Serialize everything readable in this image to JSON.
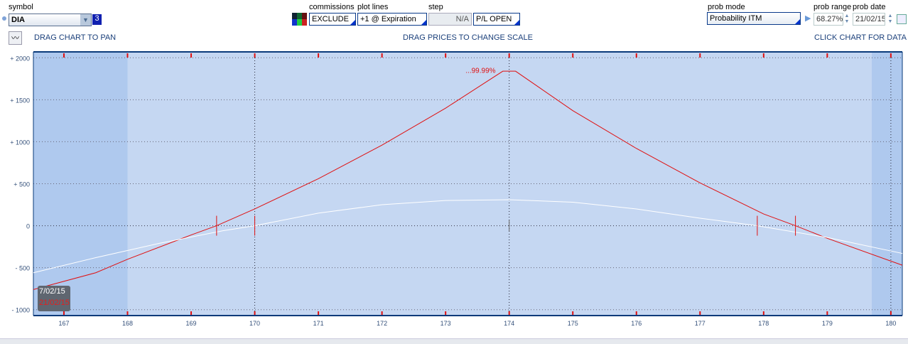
{
  "header": {
    "symbol_label": "symbol",
    "symbol_value": "DIA",
    "symbol_count": "3",
    "commissions_label": "commissions",
    "commissions_value": "EXCLUDE",
    "plot_lines_label": "plot lines",
    "plot_lines_value": "+1 @ Expiration",
    "step_label": "step",
    "step_value": "N/A",
    "pl_mode": "P/L OPEN",
    "prob_mode_label": "prob mode",
    "prob_mode_value": "Probability ITM",
    "prob_range_label": "prob range",
    "prob_range_value": "68.27%",
    "prob_date_label": "prob date",
    "prob_date_value": "21/02/15"
  },
  "hints": {
    "pan": "DRAG CHART TO PAN",
    "scale": "DRAG PRICES TO CHANGE SCALE",
    "data": "CLICK CHART FOR DATA"
  },
  "legend": {
    "t0_date": "7/02/15",
    "exp_date": "21/02/15"
  },
  "colors": {
    "expiration": "#e01010",
    "today": "#ffffff",
    "bg": "#c5d7f2",
    "bg_outside": "#afc9ee"
  },
  "chart_data": {
    "type": "line",
    "xlim": [
      166.52,
      180.18
    ],
    "ylim": [
      -1070,
      2070
    ],
    "xticks": [
      167,
      168,
      169,
      170,
      171,
      172,
      173,
      174,
      175,
      176,
      177,
      178,
      179,
      180
    ],
    "yticks": [
      {
        "v": 2000,
        "label": "+ 2000"
      },
      {
        "v": 1500,
        "label": "+ 1500"
      },
      {
        "v": 1000,
        "label": "+ 1000"
      },
      {
        "v": 500,
        "label": "+ 500"
      },
      {
        "v": 0,
        "label": "0"
      },
      {
        "v": -500,
        "label": "- 500"
      },
      {
        "v": -1000,
        "label": "- 1000"
      }
    ],
    "prob_range": [
      168,
      179.7
    ],
    "peak_label": "...99.99%",
    "series": [
      {
        "name": "21/02/15",
        "x": [
          166.52,
          167.5,
          168,
          169,
          169.4,
          170,
          171,
          172,
          173,
          173.9,
          174.1,
          175,
          176,
          177,
          178,
          178.5,
          179,
          180.18
        ],
        "y": [
          -760,
          -560,
          -400,
          -110,
          0,
          200,
          560,
          960,
          1400,
          1840,
          1840,
          1370,
          920,
          510,
          140,
          0,
          -150,
          -470
        ]
      },
      {
        "name": "7/02/15",
        "x": [
          166.52,
          167.5,
          168.5,
          169.5,
          170,
          171,
          172,
          173,
          174,
          175,
          176,
          177,
          177.9,
          179,
          180.18
        ],
        "y": [
          -560,
          -380,
          -210,
          -60,
          0,
          150,
          250,
          300,
          310,
          280,
          200,
          90,
          0,
          -140,
          -330
        ]
      }
    ],
    "breakevens": [
      169.4,
      170,
      174,
      177.9,
      178.5
    ]
  }
}
